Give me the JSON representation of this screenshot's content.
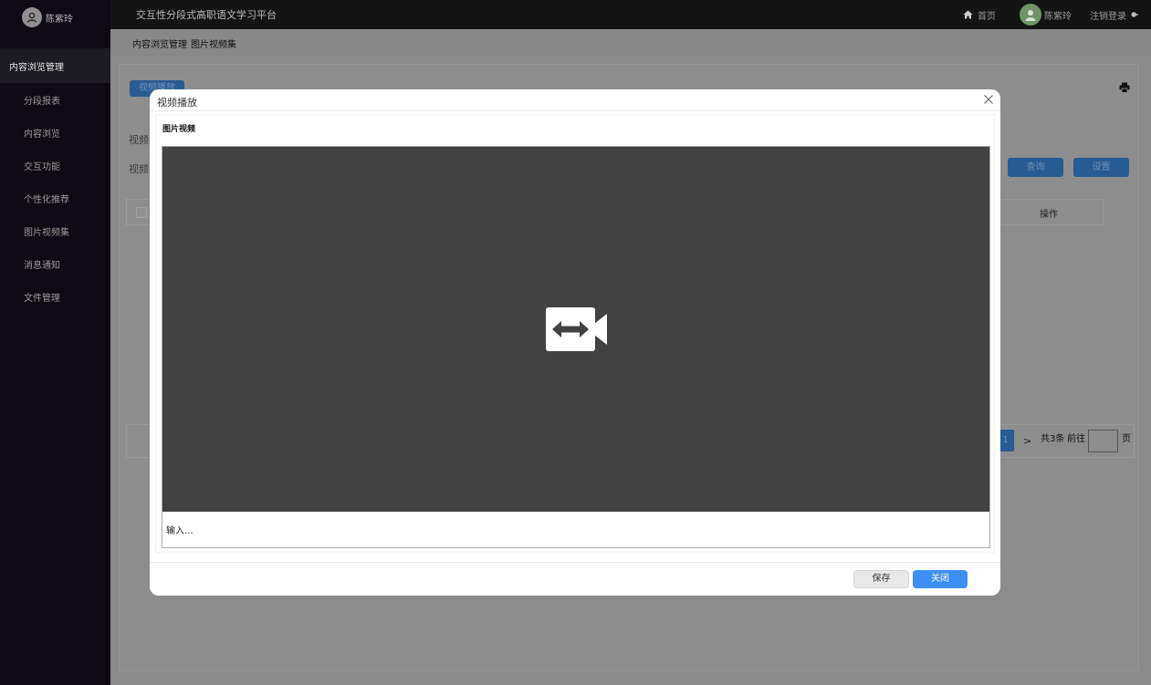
{
  "sidebar": {
    "user_name": "陈紫玲",
    "group_label": "内容浏览管理",
    "items": [
      {
        "label": "分段报表"
      },
      {
        "label": "内容浏览"
      },
      {
        "label": "交互功能"
      },
      {
        "label": "个性化推荐"
      },
      {
        "label": "图片视频集"
      },
      {
        "label": "消息通知"
      },
      {
        "label": "文件管理"
      }
    ]
  },
  "topbar": {
    "title": "交互性分段式高职语文学习平台",
    "home_label": "首页",
    "user_name": "陈紫玲",
    "logout_label": "注销登录"
  },
  "breadcrumb": {
    "items": [
      "内容浏览管理",
      "图片视频集"
    ]
  },
  "background": {
    "add_button_label": "视频播放",
    "filter_labels": [
      "视频",
      "视频"
    ],
    "query_button": "查询",
    "settings_button": "设置",
    "table_header_action": "操作",
    "pagination": {
      "current_page": "1",
      "next": ">",
      "total_text": "共3条",
      "goto_label": "前往",
      "page_unit": "页"
    }
  },
  "dialog": {
    "title": "视频播放",
    "section_title": "图片视频",
    "caption_placeholder": "输入...",
    "save_label": "保存",
    "close_label": "关闭"
  },
  "colors": {
    "sidebar_bg": "#0e0914",
    "primary": "#3d8ff5",
    "video_bg": "#424242"
  },
  "icons": {
    "user_avatar": "user-circle-icon",
    "home": "home-icon",
    "logout": "logout-icon",
    "print": "print-icon",
    "close": "close-icon",
    "video": "video-camera-icon"
  }
}
